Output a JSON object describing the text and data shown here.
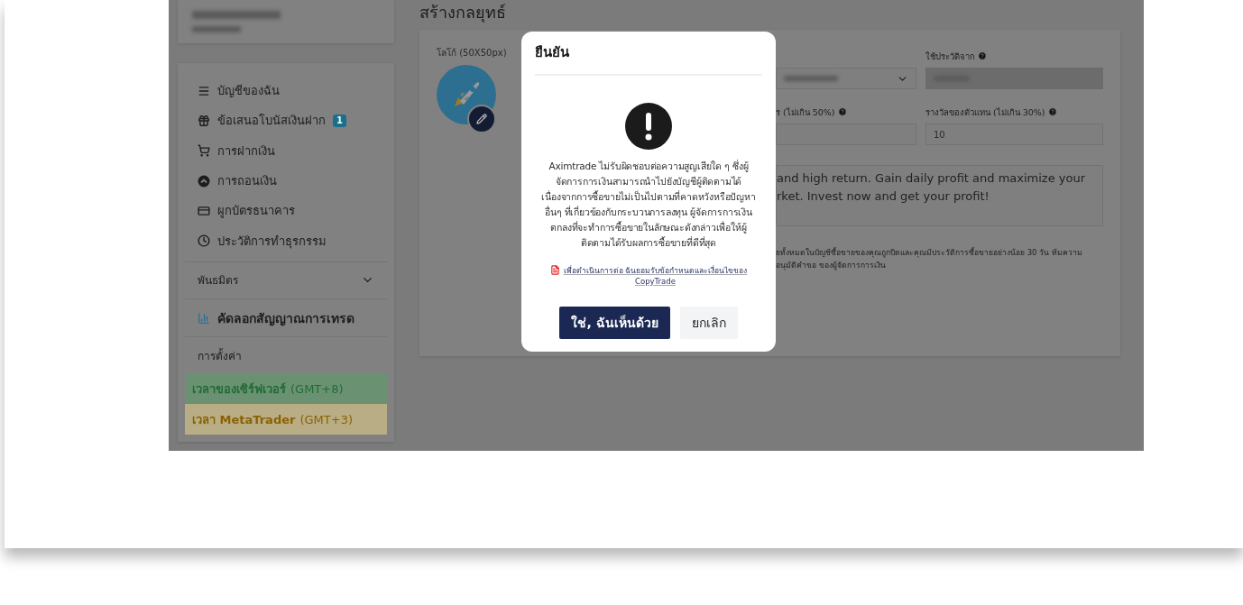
{
  "sidebar": {
    "menu": [
      {
        "label": "บัญชีของฉัน"
      },
      {
        "label": "ข้อเสนอโบนัสเงินฝาก",
        "badge": "1"
      },
      {
        "label": "การฝากเงิน"
      },
      {
        "label": "การถอนเงิน"
      },
      {
        "label": "ผูกบัตรธนาคาร"
      },
      {
        "label": "ประวัติการทำธุรกรรม"
      }
    ],
    "sections": [
      {
        "kind": "dropdown",
        "label": "พันธมิตร",
        "expanded": false
      },
      {
        "kind": "active",
        "label": "คัดลอกสัญญาณการเทรด"
      },
      {
        "kind": "plain",
        "label": "การตั้งค่า"
      }
    ],
    "times": [
      {
        "label": "เวลาของเซิร์ฟเวอร์",
        "zone": "(GMT+8)",
        "color": "#236b36"
      },
      {
        "label": "เวลา MetaTrader",
        "zone": "(GMT+3)",
        "color": "#8a6200"
      }
    ]
  },
  "main": {
    "title": "สร้างกลยุทธ์",
    "logo_label": "โลโก้ (50X50px)",
    "row1": [
      {
        "kind": "select"
      },
      {
        "kind": "date",
        "label": "ใช้ประวัติจาก",
        "help": true,
        "disabled": true
      }
    ],
    "row2": [
      {
        "label": "ร (ไม่เกิน 50%)",
        "help": true
      },
      {
        "label": "รางวัลของตัวแทน (ไม่เกิน 30%)",
        "help": true,
        "value": "10"
      }
    ],
    "description": "and high return. Gain daily profit and maximize your\nrket. Invest now and get your profit!",
    "note": "ยทั้งหมดในบัญชีซื้อขายของคุณถูกปิดและคุณมีประวัติการซื้อขายอย่างน้อย 30 วัน ทีมความ\nอนุมัติคำขอ ของผู้จัดการการเงิน"
  },
  "modal": {
    "title": "ยืนยัน",
    "message": "Aximtrade ไม่รับผิดชอบต่อความสูญเสียใด ๆ ซึ่งผู้\nจัดการการเงินสามารถนำไปยังบัญชีผู้ติดตามได้\nเนื่องจากการซื้อขายไม่เป็นไปตามที่คาดหวังหรือปัญหา\nอื่นๆ ที่เกี่ยวข้องกับกระบวนการลงทุน ผู้จัดการการเงิน\nตกลงที่จะทำการซื้อขายในลักษณะดังกล่าวเพื่อให้ผู้\nติดตามได้รับผลการซื้อขายที่ดีที่สุด",
    "terms_link": "เพื่อดำเนินการต่อ ฉันยอมรับข้อกำหนดและเงื่อนไขของ\nCopyTrade",
    "buttons": [
      {
        "label": "ใช่, ฉันเห็นด้วย",
        "kind": "primary"
      },
      {
        "label": "ยกเลิก",
        "kind": "secondary"
      }
    ]
  }
}
